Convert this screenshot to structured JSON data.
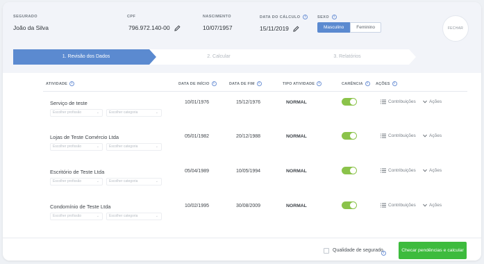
{
  "header": {
    "segurado": {
      "label": "SEGURADO",
      "value": "João da Silva"
    },
    "cpf": {
      "label": "CPF",
      "value": "796.972.140-00"
    },
    "nascimento": {
      "label": "NASCIMENTO",
      "value": "10/07/1957"
    },
    "data_calculo": {
      "label": "DATA DO CÁLCULO",
      "value": "15/11/2019"
    },
    "sexo": {
      "label": "SEXO",
      "options": [
        "Masculino",
        "Feminino"
      ],
      "selected": "Masculino"
    },
    "close_label": "FECHAR"
  },
  "stepper": {
    "steps": [
      "1. Revisão dos Dados",
      "2. Calcular",
      "3. Relatórios"
    ],
    "active_index": 0
  },
  "table": {
    "columns": [
      "ATIVIDADE",
      "DATA DE INÍCIO",
      "DATA DE FIM",
      "TIPO ATIVIDADE",
      "CARÊNCIA",
      "AÇÕES"
    ],
    "profession_placeholder": "Escolher profissão",
    "category_placeholder": "Escolher categoria",
    "contrib_label": "Contribuições",
    "actions_label": "Ações",
    "rows": [
      {
        "name": "Serviço de teste",
        "start": "10/01/1976",
        "end": "15/12/1976",
        "type": "NORMAL",
        "carencia": true
      },
      {
        "name": "Lojas de Teste Comércio Ltda",
        "start": "05/01/1982",
        "end": "20/12/1988",
        "type": "NORMAL",
        "carencia": true
      },
      {
        "name": "Escritório de Teste Ltda",
        "start": "05/04/1989",
        "end": "10/05/1994",
        "type": "NORMAL",
        "carencia": true
      },
      {
        "name": "Condomínio de Teste Ltda",
        "start": "10/02/1995",
        "end": "30/08/2009",
        "type": "NORMAL",
        "carencia": true
      }
    ]
  },
  "footer": {
    "checkbox_label": "Qualidade de segurado",
    "calc_button": "Checar pendências e calcular"
  },
  "colors": {
    "primary": "#5b8ad0",
    "success": "#3dbb3d",
    "toggle": "#8bc34a"
  }
}
